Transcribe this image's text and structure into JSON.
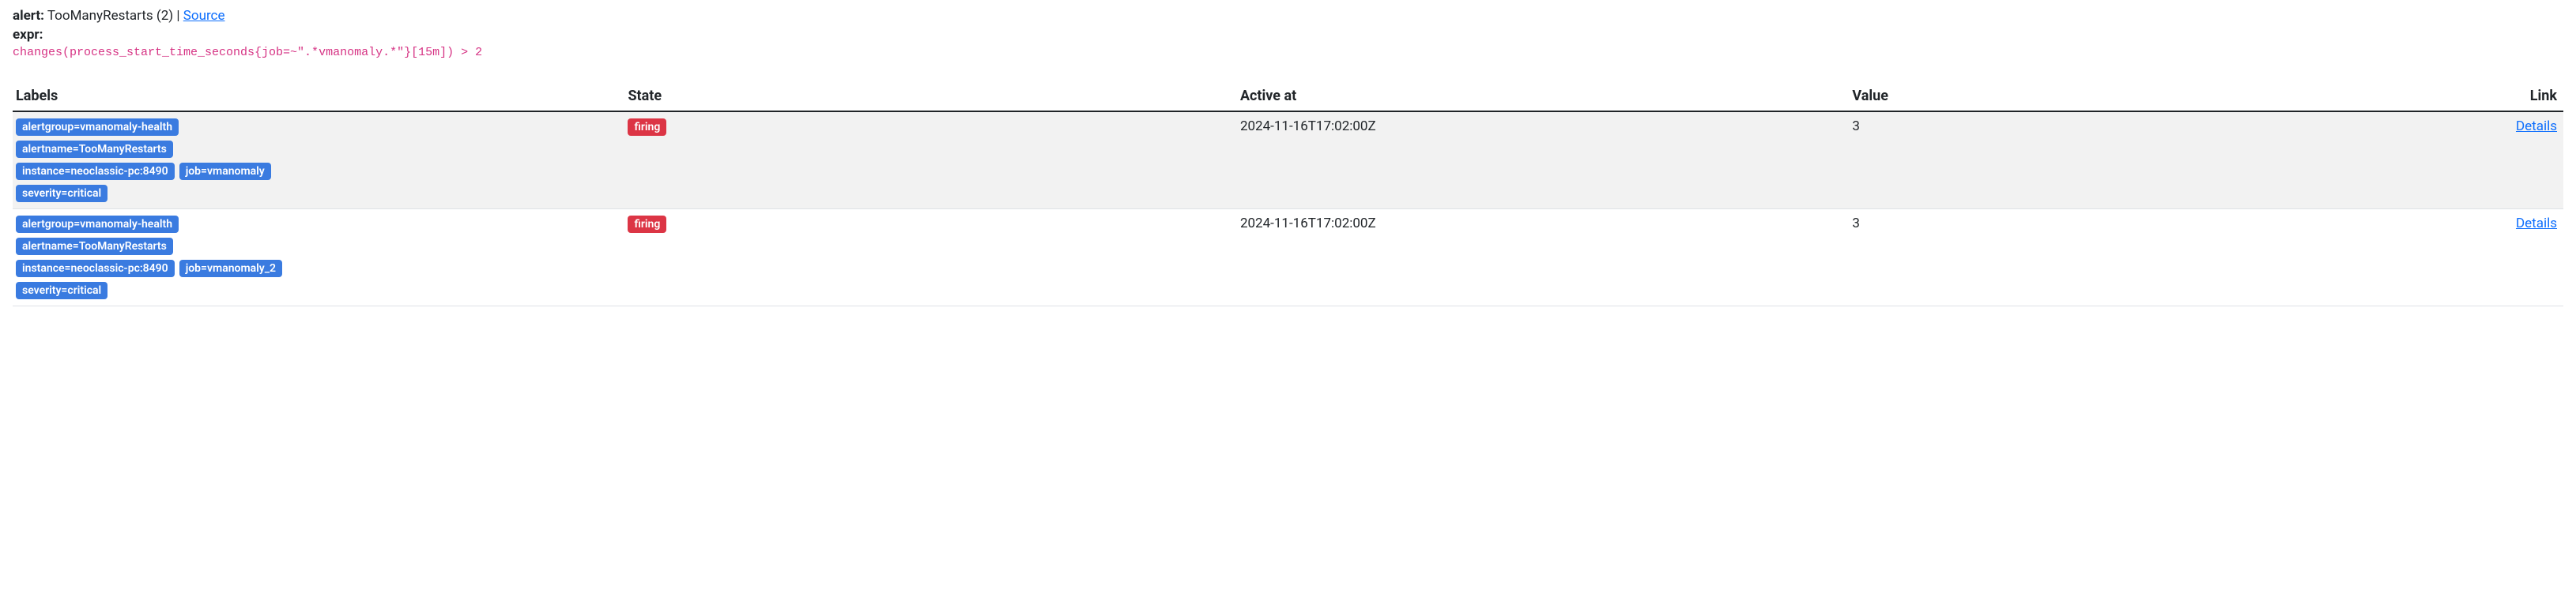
{
  "header": {
    "alert_label": "alert:",
    "alert_name": "TooManyRestarts (2)",
    "separator": "|",
    "source_text": "Source",
    "expr_label": "expr:",
    "expr_value": "changes(process_start_time_seconds{job=~\".*vmanomaly.*\"}[15m]) > 2"
  },
  "table": {
    "headers": {
      "labels": "Labels",
      "state": "State",
      "active_at": "Active at",
      "value": "Value",
      "link": "Link"
    },
    "rows": [
      {
        "labels": [
          "alertgroup=vmanomaly-health",
          "alertname=TooManyRestarts",
          "instance=neoclassic-pc:8490",
          "job=vmanomaly",
          "severity=critical"
        ],
        "state": "firing",
        "active_at": "2024-11-16T17:02:00Z",
        "value": "3",
        "link_text": "Details"
      },
      {
        "labels": [
          "alertgroup=vmanomaly-health",
          "alertname=TooManyRestarts",
          "instance=neoclassic-pc:8490",
          "job=vmanomaly_2",
          "severity=critical"
        ],
        "state": "firing",
        "active_at": "2024-11-16T17:02:00Z",
        "value": "3",
        "link_text": "Details"
      }
    ]
  }
}
